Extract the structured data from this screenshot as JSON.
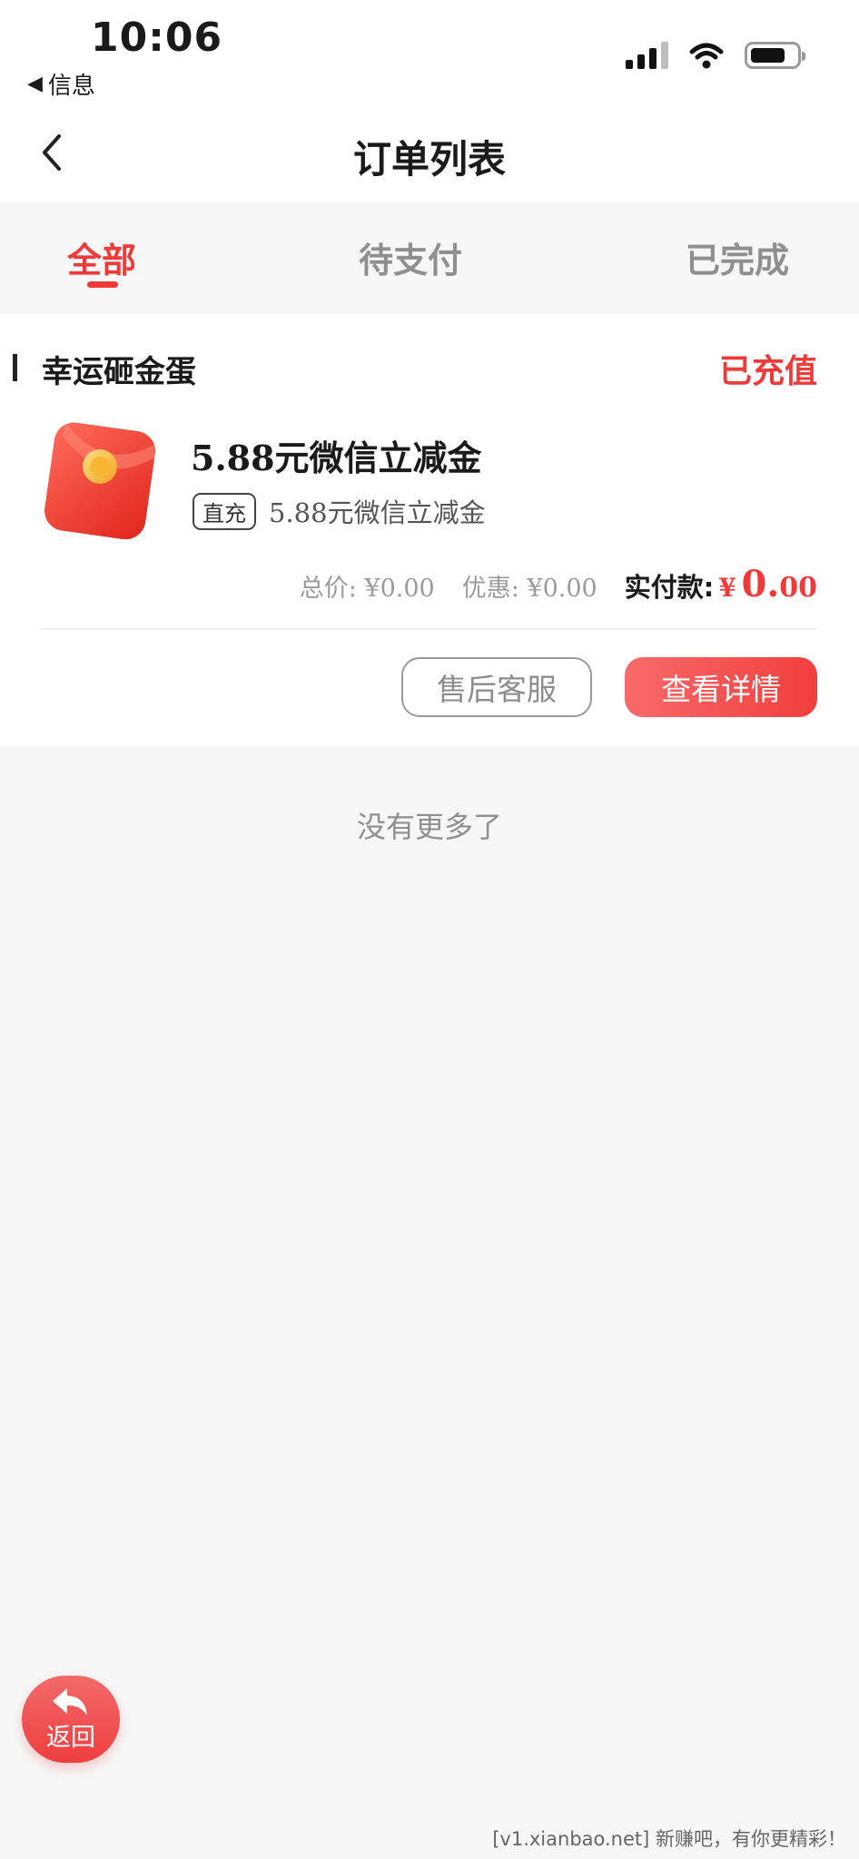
{
  "status_bar": {
    "time": "10:06",
    "back_app": "信息"
  },
  "nav": {
    "title": "订单列表"
  },
  "tabs": [
    {
      "label": "全部",
      "active": true
    },
    {
      "label": "待支付",
      "active": false
    },
    {
      "label": "已完成",
      "active": false
    }
  ],
  "order": {
    "shop": "幸运砸金蛋",
    "status": "已充值",
    "product_title": "5.88元微信立减金",
    "tag": "直充",
    "product_sub": "5.88元微信立减金",
    "total_label": "总价:",
    "total_value": "¥0.00",
    "discount_label": "优惠:",
    "discount_value": "¥0.00",
    "paid_label": "实付款:",
    "paid_symbol": "¥",
    "paid_int": "0.",
    "paid_dec": "00",
    "buttons": {
      "service": "售后客服",
      "detail": "查看详情"
    }
  },
  "list_footer": "没有更多了",
  "float_back_label": "返回",
  "watermark": "[v1.xianbao.net] 新赚吧，有你更精彩！",
  "colors": {
    "accent": "#f03a3a",
    "background": "#f7f7f7"
  }
}
